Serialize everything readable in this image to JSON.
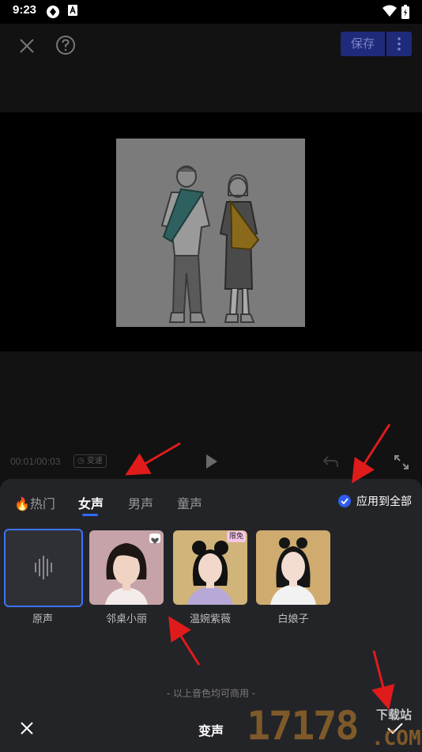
{
  "status_bar": {
    "time": "9:23"
  },
  "toolbar": {
    "save_label": "保存"
  },
  "playback": {
    "time": "00:01/00:03",
    "speed_label": "变速"
  },
  "tabs": [
    {
      "label": "🔥热门"
    },
    {
      "label": "女声"
    },
    {
      "label": "男声"
    },
    {
      "label": "童声"
    }
  ],
  "active_tab": "女声",
  "apply_all": {
    "label": "应用到全部",
    "checked": true
  },
  "voices": [
    {
      "label": "原声"
    },
    {
      "label": "邻桌小丽",
      "badge": "heart"
    },
    {
      "label": "温婉紫薇",
      "badge": "限免"
    },
    {
      "label": "白娘子"
    }
  ],
  "footnote": "- 以上音色均可商用 -",
  "sheet_title": "变声",
  "watermark": {
    "digits": "17178",
    "site": "下载站",
    "domain": ".COM"
  },
  "colors": {
    "accent": "#2f6bff",
    "save_bg": "#1f2a7a",
    "sheet_bg": "#232428",
    "annotation": "#e01b1b"
  }
}
